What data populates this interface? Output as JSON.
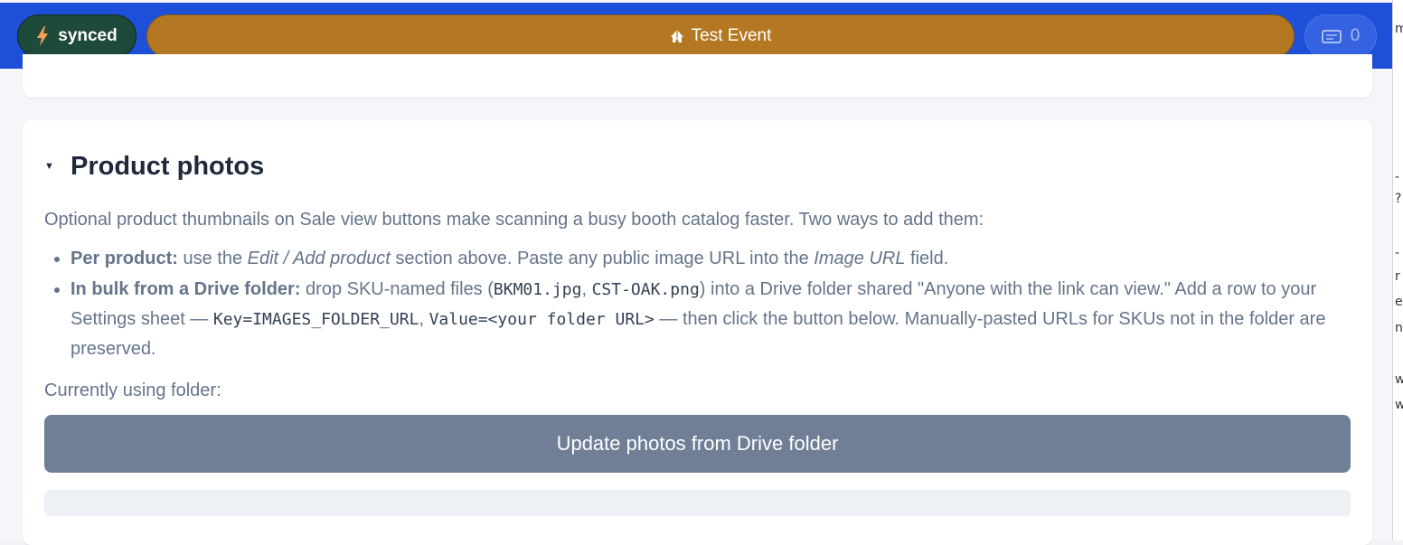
{
  "header": {
    "sync_label": "synced",
    "event_label": "Test Event",
    "cart_count": "0"
  },
  "section": {
    "title": "Product photos",
    "intro": "Optional product thumbnails on Sale view buttons make scanning a busy booth catalog faster. Two ways to add them:",
    "bullet1": {
      "lead": "Per product:",
      "t1": " use the ",
      "em1": "Edit / Add product",
      "t2": " section above. Paste any public image URL into the ",
      "em2": "Image URL",
      "t3": " field."
    },
    "bullet2": {
      "lead": "In bulk from a Drive folder:",
      "t1": " drop SKU-named files (",
      "code1": "BKM01.jpg",
      "t2": ", ",
      "code2": "CST-OAK.png",
      "t3": ") into a Drive folder shared \"Anyone with the link can view.\" Add a row to your Settings sheet — ",
      "code3": "Key=IMAGES_FOLDER_URL",
      "t4": ", ",
      "code4": "Value=<your folder URL>",
      "t5": " — then click the button below. Manually-pasted URLs for SKUs not in the folder are preserved."
    },
    "folder_label": "Currently using folder:",
    "update_button": "Update photos from Drive folder",
    "status_text": ""
  },
  "side_strip": {
    "chars": [
      "m",
      "-",
      "?",
      "-",
      "r",
      "e",
      "n",
      "w",
      "w"
    ]
  },
  "colors": {
    "topbar": "#1d4fd8",
    "sync_pill": "#1e4a3a",
    "event_pill": "#b37821",
    "button": "#717f96"
  },
  "icons": [
    "bolt-icon",
    "tent-icon",
    "cart-icon",
    "caret-down-icon"
  ]
}
